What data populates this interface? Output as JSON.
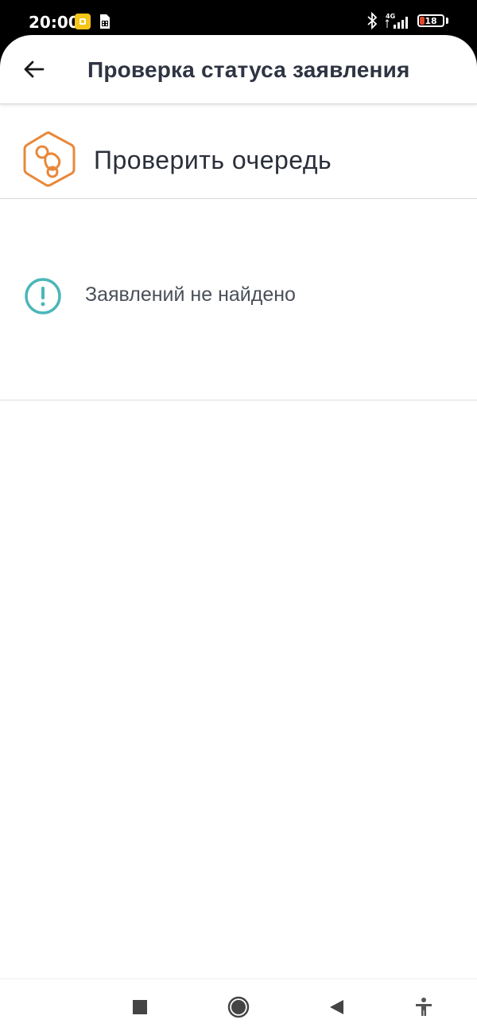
{
  "status_bar": {
    "time": "20:00",
    "network": "4G",
    "battery": "18",
    "icons": [
      "notification-icon",
      "sim-icon",
      "bluetooth-icon",
      "signal-icon",
      "battery-icon"
    ],
    "battery_color": "#e0472b"
  },
  "header": {
    "title": "Проверка статуса заявления",
    "back_icon": "arrow-left-icon"
  },
  "queue": {
    "label": "Проверить очередь",
    "icon": "pacifier-hexagon-icon",
    "icon_color": "#e8883a"
  },
  "notice": {
    "text": "Заявлений не найдено",
    "icon": "exclamation-circle-icon",
    "icon_color": "#4cb6b8"
  },
  "nav_bar": {
    "buttons": [
      "recents-square-icon",
      "home-circle-icon",
      "back-triangle-icon",
      "accessibility-icon"
    ]
  }
}
